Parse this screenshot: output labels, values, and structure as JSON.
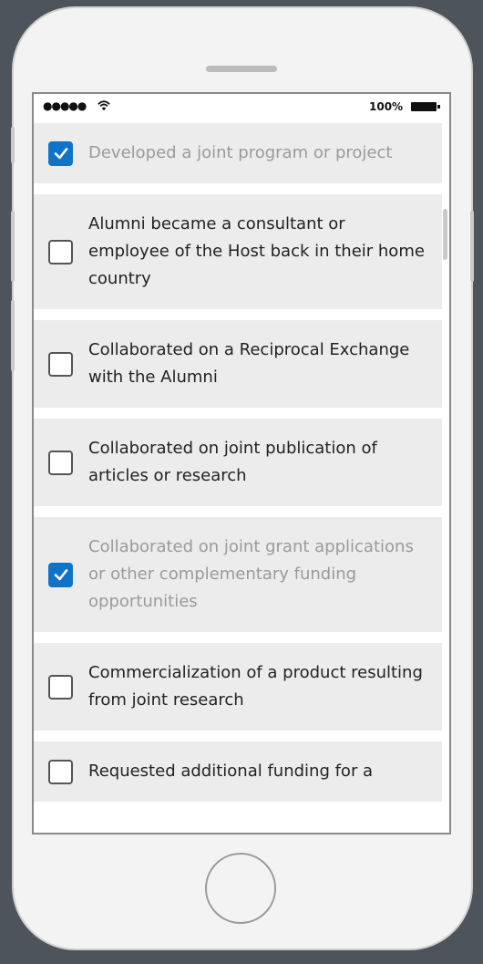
{
  "status_bar": {
    "signal": "●●●●●",
    "battery": "100%"
  },
  "items": [
    {
      "label": "Developed a joint program or project",
      "checked": true
    },
    {
      "label": "Alumni became a consultant or employee of the Host back in their home country",
      "checked": false
    },
    {
      "label": "Collaborated on a Reciprocal Exchange with the Alumni",
      "checked": false
    },
    {
      "label": "Collaborated on joint publication of articles or research",
      "checked": false
    },
    {
      "label": "Collaborated on joint grant applications or other complementary funding opportunities",
      "checked": true
    },
    {
      "label": "Commercialization of a product resulting from joint research",
      "checked": false
    },
    {
      "label": "Requested additional funding for a",
      "checked": false
    }
  ],
  "colors": {
    "accent": "#0f74c8",
    "frame": "#f3f3f3",
    "background": "#4d545b"
  }
}
